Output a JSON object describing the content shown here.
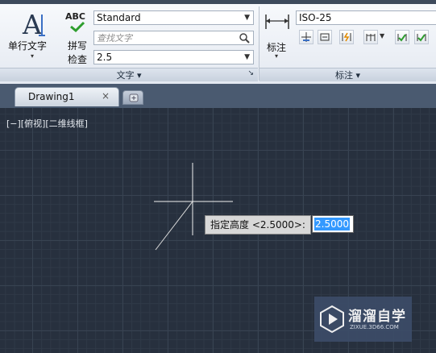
{
  "ribbon": {
    "text_panel": {
      "single_line_text_label": "单行文字",
      "spell_check_label_1": "拼写",
      "spell_check_label_2": "检查",
      "abc_label": "ABC",
      "style_value": "Standard",
      "find_placeholder": "查找文字",
      "height_value": "2.5",
      "footer_label": "文字 ▾",
      "corner_label": "↘"
    },
    "dimension_panel": {
      "dimension_label": "标注",
      "dim_style_value": "ISO-25",
      "footer_label": "标注 ▾"
    }
  },
  "tabs": {
    "document_tab_label": "Drawing1",
    "close_label": "×"
  },
  "viewport": {
    "control_label": "[−][俯视][二维线框]"
  },
  "prompt": {
    "label": "指定高度 <2.5000>:",
    "input_value": "2.5000"
  },
  "watermark": {
    "title": "溜溜自学",
    "url": "ZIXUE.3D66.COM"
  },
  "colors": {
    "canvas": "#27303e",
    "selection": "#3399ff",
    "watermark_bg": "#3c4c68"
  }
}
